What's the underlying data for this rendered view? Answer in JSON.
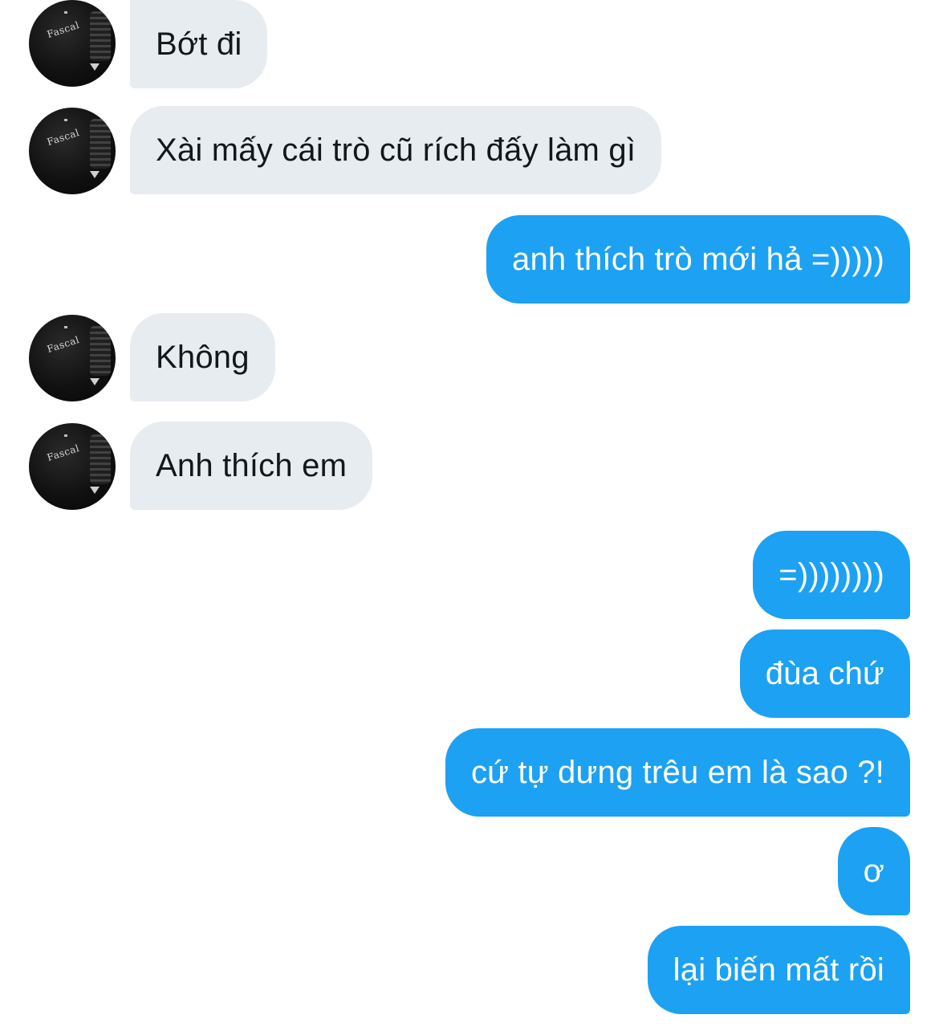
{
  "colors": {
    "incoming_bubble": "#e6ecf0",
    "outgoing_bubble": "#1da1f2",
    "incoming_text": "#14171a",
    "outgoing_text": "#ffffff"
  },
  "avatar": {
    "icon": "user-avatar-icon",
    "shirt_text": "Fascal"
  },
  "messages": [
    {
      "sender": "them",
      "text": "Bớt đi"
    },
    {
      "sender": "them",
      "text": "Xài mấy cái trò cũ rích đấy làm gì"
    },
    {
      "sender": "me",
      "text": "anh thích trò mới hả =)))))"
    },
    {
      "sender": "them",
      "text": "Không"
    },
    {
      "sender": "them",
      "text": "Anh thích em"
    },
    {
      "sender": "me",
      "text": "=))))))))"
    },
    {
      "sender": "me",
      "text": "đùa chứ"
    },
    {
      "sender": "me",
      "text": "cứ tự dưng trêu em là sao ?!"
    },
    {
      "sender": "me",
      "text": "ơ"
    },
    {
      "sender": "me",
      "text": "lại biến mất rồi"
    }
  ]
}
